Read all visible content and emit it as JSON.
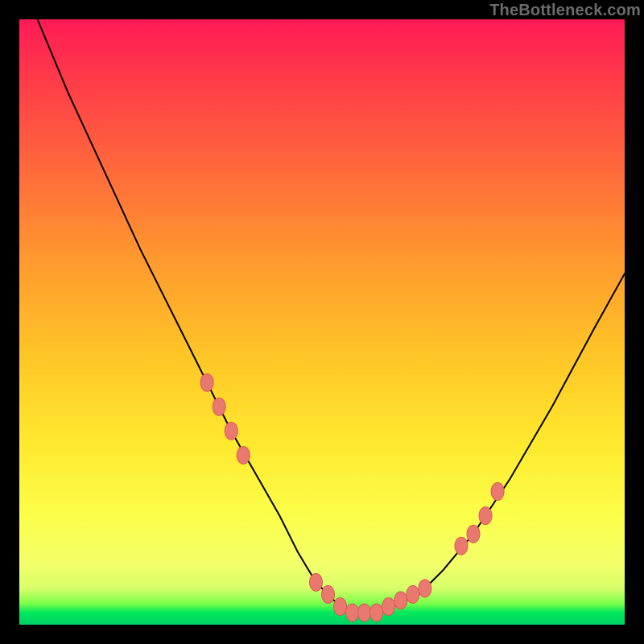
{
  "watermark": "TheBottleneck.com",
  "colors": {
    "background": "#000000",
    "curve_stroke": "#000000",
    "marker_fill": "#e9796f",
    "marker_stroke": "#db5b52"
  },
  "chart_data": {
    "type": "line",
    "title": "",
    "xlabel": "",
    "ylabel": "",
    "xlim": [
      0,
      100
    ],
    "ylim": [
      0,
      100
    ],
    "grid": false,
    "legend": false,
    "annotations": [],
    "series": [
      {
        "name": "bottleneck-curve",
        "x": [
          3,
          8,
          14,
          20,
          26,
          31,
          35,
          39,
          43,
          46,
          49,
          52,
          55,
          58,
          62,
          66,
          70,
          75,
          81,
          88,
          95,
          100
        ],
        "y": [
          100,
          88,
          75,
          62,
          50,
          40,
          32,
          25,
          18,
          12,
          7,
          4,
          2,
          2,
          3,
          5,
          9,
          15,
          24,
          36,
          49,
          58
        ]
      }
    ],
    "markers": [
      {
        "x": 31,
        "y": 40
      },
      {
        "x": 33,
        "y": 36
      },
      {
        "x": 35,
        "y": 32
      },
      {
        "x": 37,
        "y": 28
      },
      {
        "x": 49,
        "y": 7
      },
      {
        "x": 51,
        "y": 5
      },
      {
        "x": 53,
        "y": 3
      },
      {
        "x": 55,
        "y": 2
      },
      {
        "x": 57,
        "y": 2
      },
      {
        "x": 59,
        "y": 2
      },
      {
        "x": 61,
        "y": 3
      },
      {
        "x": 63,
        "y": 4
      },
      {
        "x": 65,
        "y": 5
      },
      {
        "x": 67,
        "y": 6
      },
      {
        "x": 73,
        "y": 13
      },
      {
        "x": 75,
        "y": 15
      },
      {
        "x": 77,
        "y": 18
      },
      {
        "x": 79,
        "y": 22
      }
    ]
  }
}
